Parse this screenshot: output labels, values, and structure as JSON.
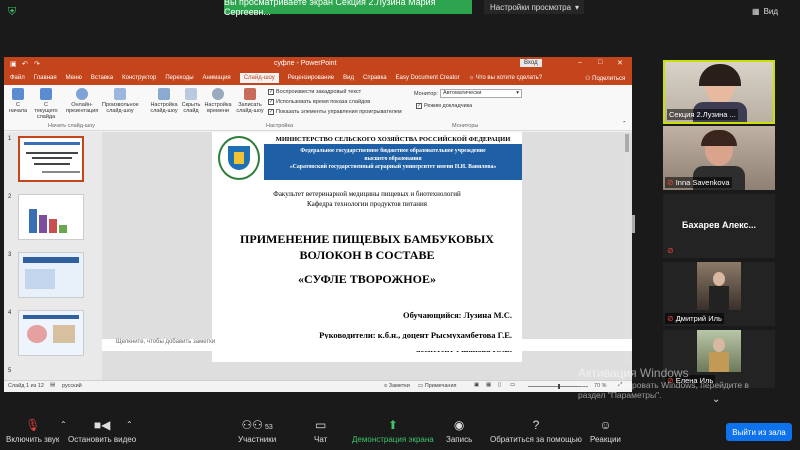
{
  "meeting": {
    "banner_text": "Вы просматриваете экран Секция 2.Лузина Мария Сергеевн...",
    "view_settings": "Настройки просмотра",
    "view_label": "Вид"
  },
  "powerpoint": {
    "title": "суфле  -  PowerPoint",
    "signin": "Вход",
    "tabs": [
      "Файл",
      "Главная",
      "Меню",
      "Вставка",
      "Конструктор",
      "Переходы",
      "Анимация",
      "Слайд-шоу",
      "Рецензирование",
      "Вид",
      "Справка",
      "Easy Document Creator",
      "Что вы хотите сделать?",
      "Поделиться"
    ],
    "active_tab": "Слайд-шоу",
    "ribbon": {
      "btn_from_start": "С начала",
      "btn_from_current": "С текущего слайда",
      "btn_online": "Онлайн-презентация",
      "btn_custom": "Произвольное слайд-шоу",
      "group_start": "Начать слайд-шоу",
      "btn_setup": "Настройка слайд-шоу",
      "btn_hide": "Скрыть слайд",
      "btn_rehearse": "Настройка времени",
      "btn_record": "Записать слайд-шоу",
      "chk_narration": "Воспроизвести закадровый текст",
      "chk_timings": "Использовать время показа слайдов",
      "chk_media": "Показать элементы управления проигрывателем",
      "group_setup": "Настройка",
      "monitor_label": "Монитор:",
      "monitor_value": "Автоматически",
      "presenter_view": "Режим докладчика",
      "group_monitors": "Мониторы"
    },
    "thumb_numbers": [
      "1",
      "2",
      "3",
      "4",
      "5"
    ],
    "notes_placeholder": "Щелкните, чтобы добавить заметки",
    "status": {
      "slide": "Слайд 1 из 12",
      "language": "русский",
      "notes": "Заметки",
      "comments": "Примечания",
      "zoom": "70 %"
    },
    "slide": {
      "ministry": "МИНИСТЕРСТВО СЕЛЬСКОГО ХОЗЯЙСТВА РОССИЙСКОЙ ФЕДЕРАЦИИ",
      "inst1": "Федеральное государственное бюджетное образовательное учреждение",
      "inst2": "высшего образования",
      "inst3": "«Саратовский государственный аграрный университет имени Н.И. Вавилова»",
      "faculty": "Факультет ветеринарной медицины пищевых и биотехнологий",
      "chair": "Кафедра технологии продуктов питания",
      "title1": "ПРИМЕНЕНИЕ ПИЩЕВЫХ БАМБУКОВЫХ",
      "title2": "ВОЛОКОН В СОСТАВЕ",
      "title3": "«СУФЛЕ ТВОРОЖНОЕ»",
      "student": "Обучающийся: Лузина М.С.",
      "supervisors1": "Руководители: к.б.н., доцент Рысмухамбетова Г.Е.",
      "supervisors2": "ассистент Ушакова Ю.В."
    }
  },
  "participants": [
    {
      "name": "Секция 2.Лузина ...",
      "muted": false
    },
    {
      "name": "Inna Savenkova",
      "muted": true
    },
    {
      "name": "Бахарев  Алекс...",
      "muted": true
    },
    {
      "name": "Дмитрий Иль",
      "muted": true
    },
    {
      "name": "Елена Иль",
      "muted": true
    }
  ],
  "activation": {
    "title": "Активация Windows",
    "line1": "Чтобы активировать Windows, перейдите в",
    "line2": "раздел \"Параметры\"."
  },
  "toolbar": {
    "audio": "Включить звук",
    "video": "Остановить видео",
    "participants": "Участники",
    "participants_count": "53",
    "chat": "Чат",
    "share": "Демонстрация экрана",
    "record": "Запись",
    "help": "Обратиться за помощью",
    "reactions": "Реакции",
    "leave": "Выйти из зала"
  },
  "colors": {
    "ppt_accent": "#c4451c",
    "banner_green": "#2da44e",
    "leave_blue": "#0e72ed",
    "share_green": "#3ec26a"
  }
}
